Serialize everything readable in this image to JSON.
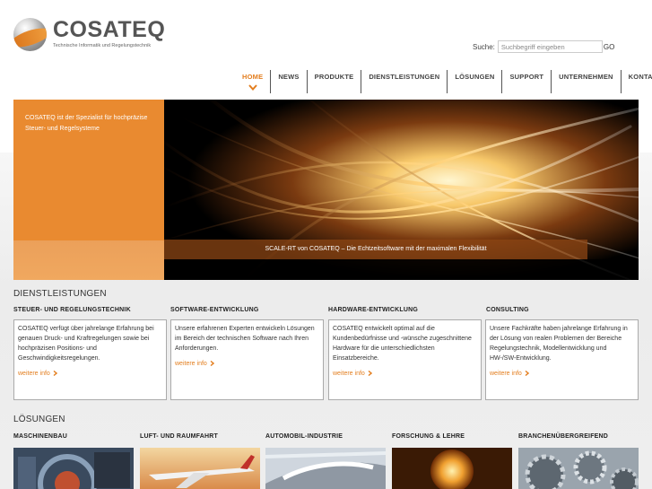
{
  "brand": {
    "name": "COSATEQ",
    "tagline": "Technische Informatik und Regelungstechnik"
  },
  "search": {
    "label": "Suche:",
    "placeholder": "Suchbegriff eingeben",
    "go": "GO"
  },
  "nav": {
    "items": [
      {
        "label": "HOME",
        "active": true
      },
      {
        "label": "NEWS"
      },
      {
        "label": "PRODUKTE"
      },
      {
        "label": "DIENSTLEISTUNGEN"
      },
      {
        "label": "LÖSUNGEN"
      },
      {
        "label": "SUPPORT"
      },
      {
        "label": "UNTERNEHMEN"
      },
      {
        "label": "KONTAKT"
      }
    ]
  },
  "hero": {
    "text": "COSATEQ ist der Spezialist für hochpräzise Steuer- und Regelsysteme",
    "caption": "SCALE-RT von COSATEQ – Die Echtzeitsoftware mit der maximalen Flexibilität"
  },
  "services": {
    "title": "DIENSTLEISTUNGEN",
    "cards": [
      {
        "heading": "STEUER- UND REGELUNGSTECHNIK",
        "text": "COSATEQ verfügt über jahrelange Erfahrung bei genauen Druck- und Kraftregelungen sowie bei hochpräzisen Positions- und Geschwindigkeitsregelungen.",
        "link": "weitere info"
      },
      {
        "heading": "SOFTWARE-ENTWICKLUNG",
        "text": "Unsere erfahrenen Experten entwickeln Lösungen im Bereich der technischen Software nach Ihren Anforderungen.",
        "link": "weitere info"
      },
      {
        "heading": "HARDWARE-ENTWICKLUNG",
        "text": "COSATEQ entwickelt optimal auf die Kundenbedürfnisse und -wünsche zugeschnittene Hardware für die unterschiedlichsten Einsatzbereiche.",
        "link": "weitere info"
      },
      {
        "heading": "CONSULTING",
        "text": "Unsere Fachkräfte haben jahrelange Erfahrung in der Lösung von realen Problemen der Bereiche Regelungstechnik, Modellentwicklung und HW-/SW-Entwicklung.",
        "link": "weitere info"
      }
    ]
  },
  "solutions": {
    "title": "LÖSUNGEN",
    "items": [
      {
        "heading": "MASCHINENBAU"
      },
      {
        "heading": "LUFT- UND RAUMFAHRT"
      },
      {
        "heading": "AUTOMOBIL-INDUSTRIE"
      },
      {
        "heading": "FORSCHUNG & LEHRE"
      },
      {
        "heading": "BRANCHENÜBERGREIFEND"
      }
    ]
  },
  "colors": {
    "accent": "#e37e1f",
    "hero_left": "#e98a30"
  }
}
